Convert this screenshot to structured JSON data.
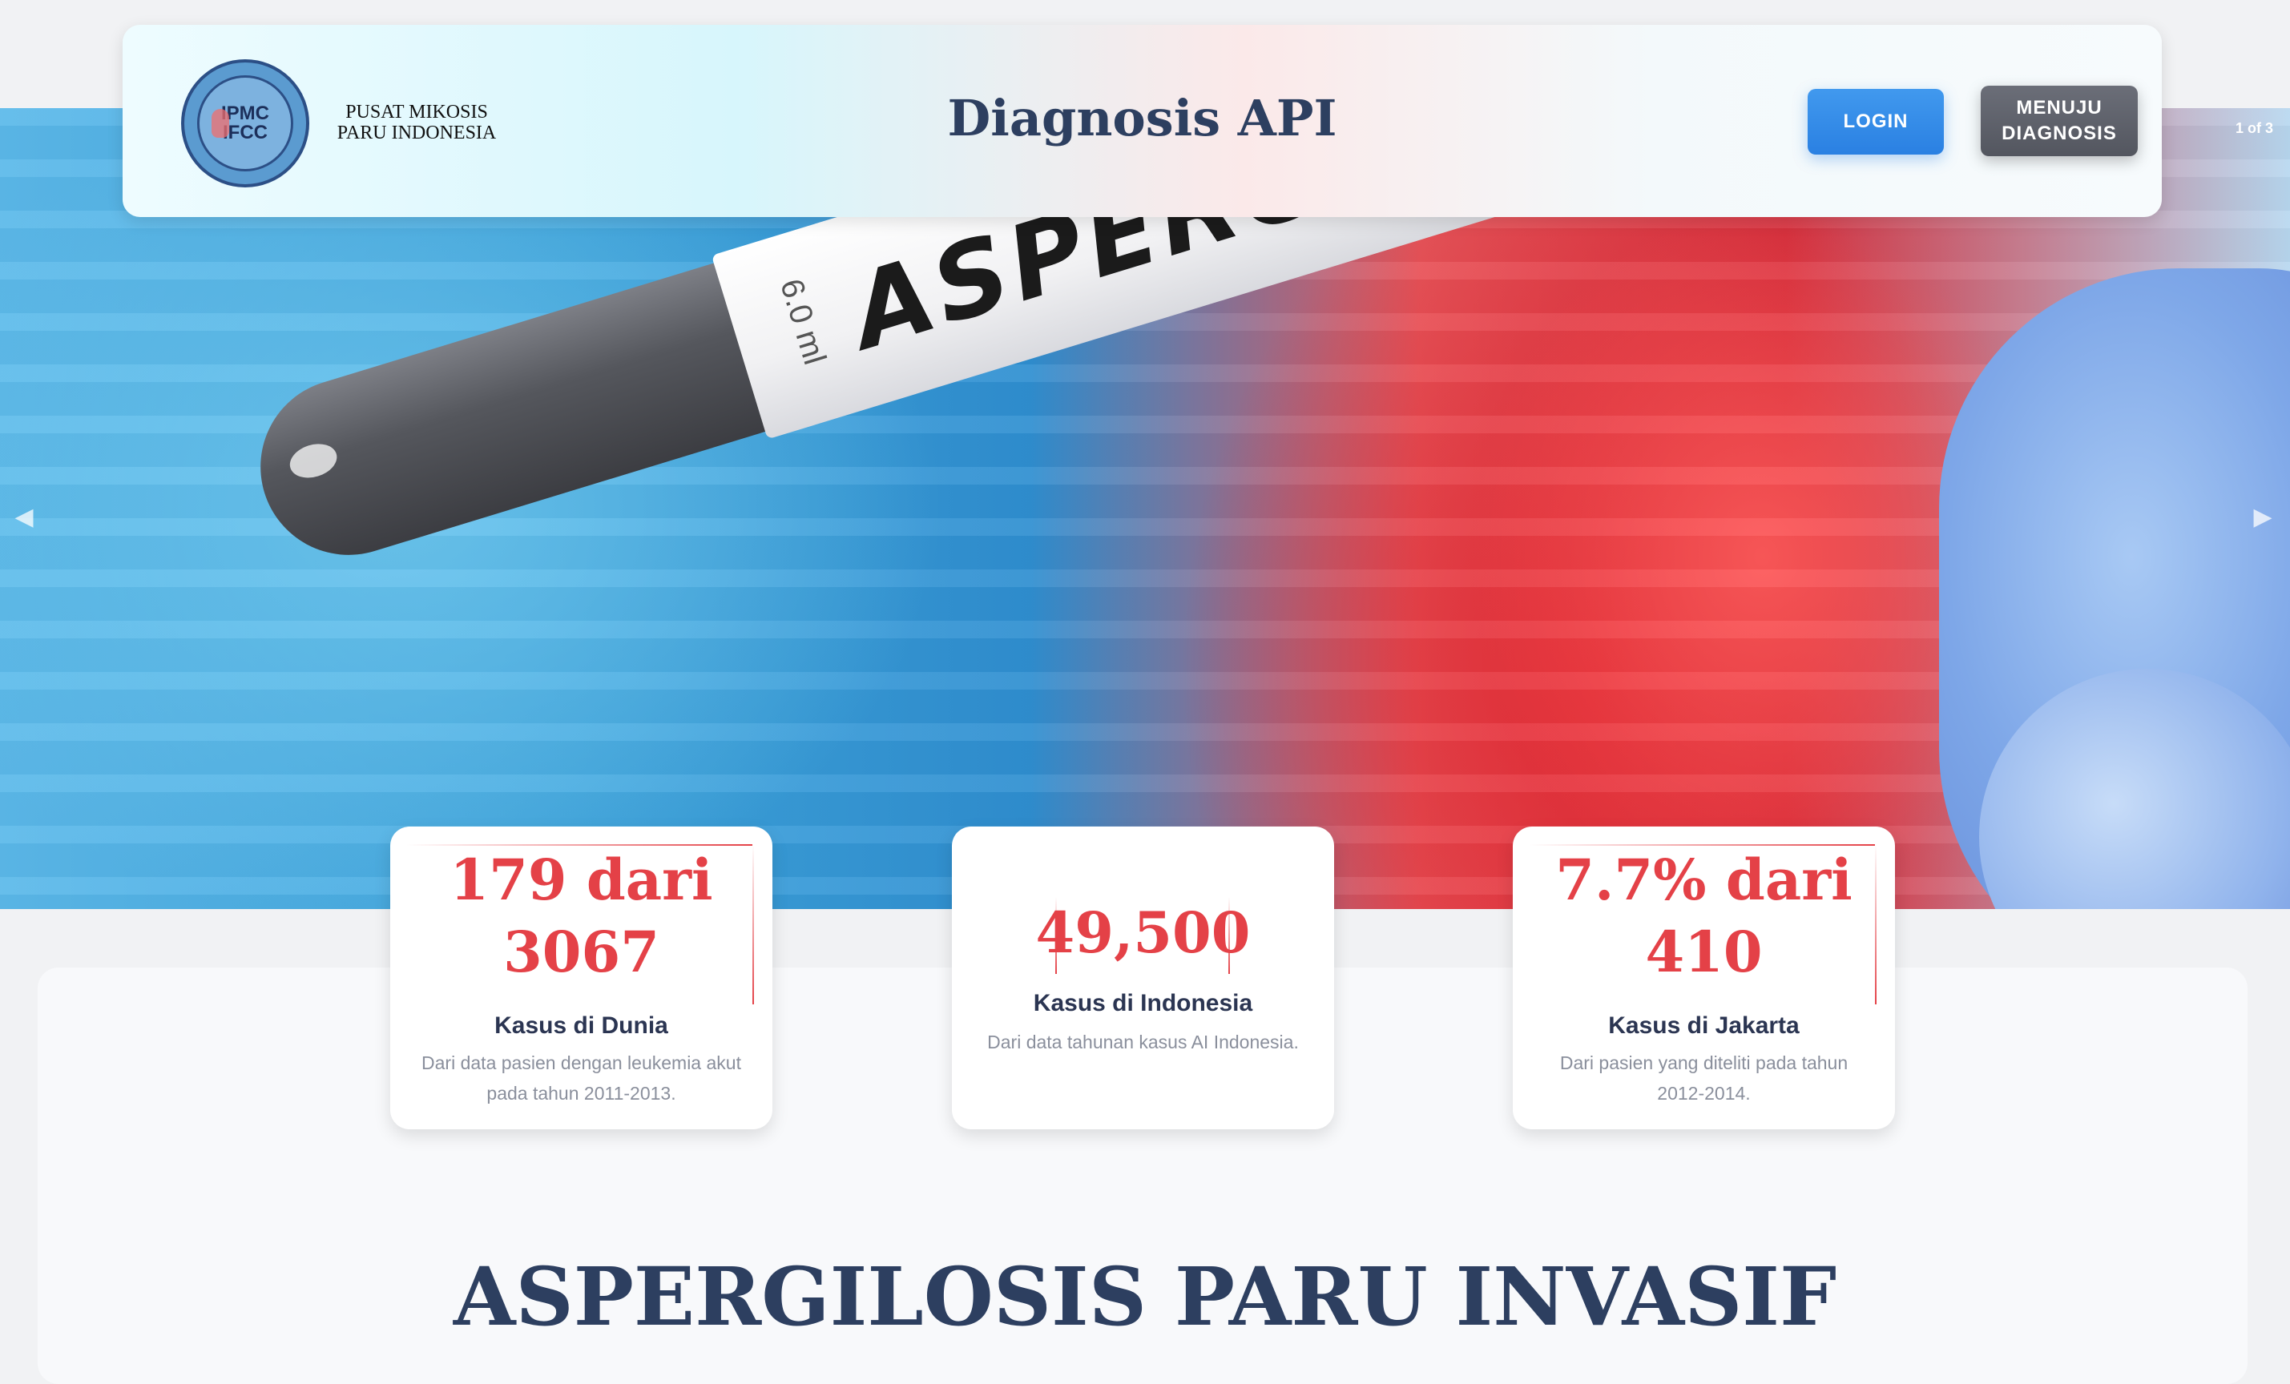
{
  "header": {
    "org_name": "PUSAT MIKOSIS PARU INDONESIA",
    "logo_text_top": "IPMC",
    "logo_text_bottom": "IFCC",
    "title": "Diagnosis API",
    "login_label": "LOGIN",
    "diagnosis_label": "MENUJU DIAGNOSIS"
  },
  "carousel": {
    "indicator": "1 of 3",
    "tube_label": "ASPERGILLOSIS",
    "tube_volume": "6.0 ml",
    "prev_icon": "chevron-left-icon",
    "next_icon": "chevron-right-icon"
  },
  "stats": [
    {
      "value": "179 dari 3067",
      "caption": "Kasus di Dunia",
      "description": "Dari data pasien dengan leukemia akut pada tahun 2011-2013."
    },
    {
      "value": "49,500",
      "caption": "Kasus di Indonesia",
      "description": "Dari data tahunan kasus AI Indonesia."
    },
    {
      "value": "7.7% dari 410",
      "caption": "Kasus di Jakarta",
      "description": "Dari pasien yang diteliti pada tahun 2012-2014."
    }
  ],
  "section": {
    "heading": "ASPERGILOSIS PARU INVASIF"
  },
  "colors": {
    "accent_blue": "#2a80e2",
    "accent_red": "#e44147",
    "heading_navy": "#2d3f60",
    "button_gray": "#53565f"
  }
}
